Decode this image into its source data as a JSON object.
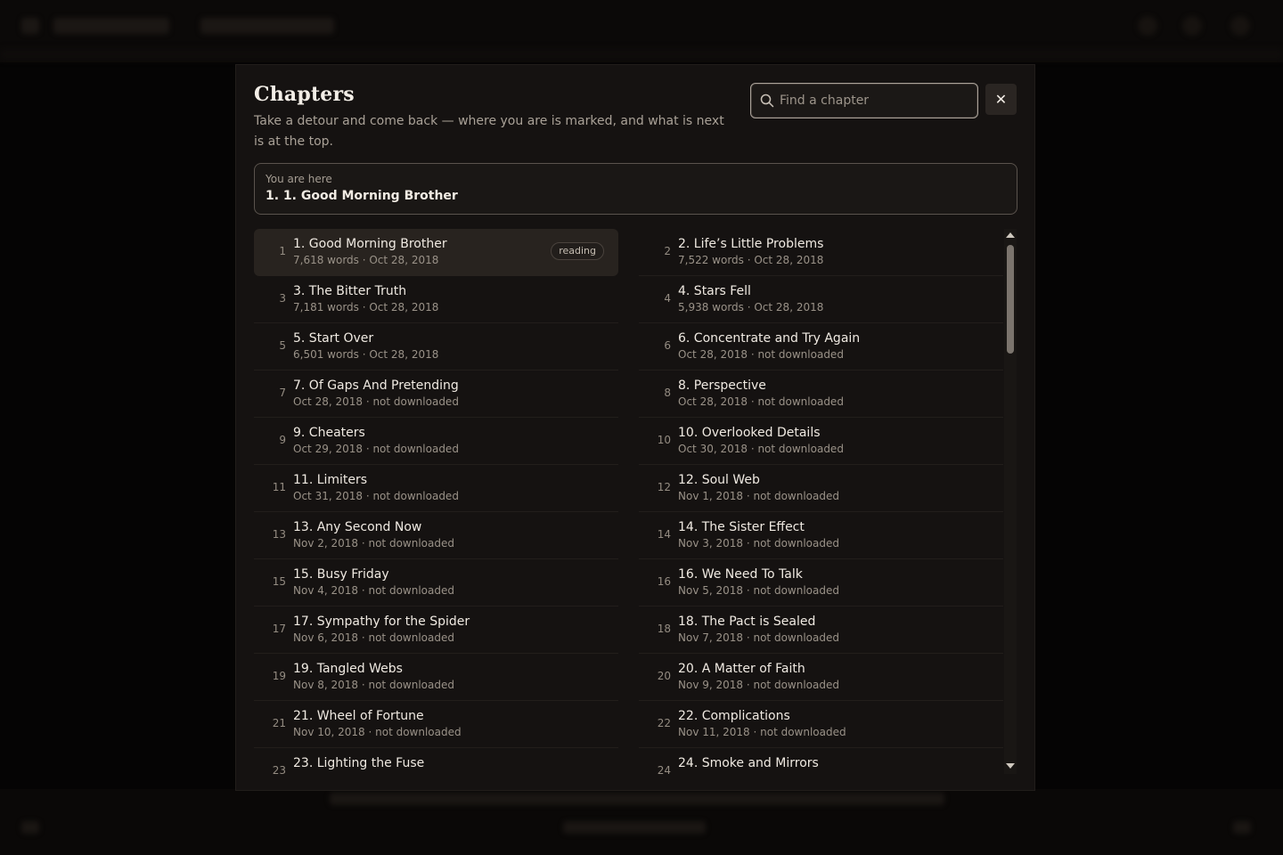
{
  "modal": {
    "title": "Chapters",
    "subtitle": "Take a detour and come back — where you are is marked, and what is next is at the top.",
    "search": {
      "placeholder": "Find a chapter",
      "value": ""
    },
    "close_label": "✕",
    "current": {
      "label": "You are here",
      "value": "1. 1. Good Morning Brother"
    },
    "reading_badge": "reading",
    "chapters": [
      {
        "num": "1",
        "title": "1. Good Morning Brother",
        "meta": "7,618 words · Oct 28, 2018",
        "active": true
      },
      {
        "num": "2",
        "title": "2. Life’s Little Problems",
        "meta": "7,522 words · Oct 28, 2018"
      },
      {
        "num": "3",
        "title": "3. The Bitter Truth",
        "meta": "7,181 words · Oct 28, 2018"
      },
      {
        "num": "4",
        "title": "4. Stars Fell",
        "meta": "5,938 words · Oct 28, 2018"
      },
      {
        "num": "5",
        "title": "5. Start Over",
        "meta": "6,501 words · Oct 28, 2018"
      },
      {
        "num": "6",
        "title": "6. Concentrate and Try Again",
        "meta": "Oct 28, 2018 · not downloaded"
      },
      {
        "num": "7",
        "title": "7. Of Gaps And Pretending",
        "meta": "Oct 28, 2018 · not downloaded"
      },
      {
        "num": "8",
        "title": "8. Perspective",
        "meta": "Oct 28, 2018 · not downloaded"
      },
      {
        "num": "9",
        "title": "9. Cheaters",
        "meta": "Oct 29, 2018 · not downloaded"
      },
      {
        "num": "10",
        "title": "10. Overlooked Details",
        "meta": "Oct 30, 2018 · not downloaded"
      },
      {
        "num": "11",
        "title": "11. Limiters",
        "meta": "Oct 31, 2018 · not downloaded"
      },
      {
        "num": "12",
        "title": "12. Soul Web",
        "meta": "Nov 1, 2018 · not downloaded"
      },
      {
        "num": "13",
        "title": "13. Any Second Now",
        "meta": "Nov 2, 2018 · not downloaded"
      },
      {
        "num": "14",
        "title": "14. The Sister Effect",
        "meta": "Nov 3, 2018 · not downloaded"
      },
      {
        "num": "15",
        "title": "15. Busy Friday",
        "meta": "Nov 4, 2018 · not downloaded"
      },
      {
        "num": "16",
        "title": "16. We Need To Talk",
        "meta": "Nov 5, 2018 · not downloaded"
      },
      {
        "num": "17",
        "title": "17. Sympathy for the Spider",
        "meta": "Nov 6, 2018 · not downloaded"
      },
      {
        "num": "18",
        "title": "18. The Pact is Sealed",
        "meta": "Nov 7, 2018 · not downloaded"
      },
      {
        "num": "19",
        "title": "19. Tangled Webs",
        "meta": "Nov 8, 2018 · not downloaded"
      },
      {
        "num": "20",
        "title": "20. A Matter of Faith",
        "meta": "Nov 9, 2018 · not downloaded"
      },
      {
        "num": "21",
        "title": "21. Wheel of Fortune",
        "meta": "Nov 10, 2018 · not downloaded"
      },
      {
        "num": "22",
        "title": "22. Complications",
        "meta": "Nov 11, 2018 · not downloaded"
      },
      {
        "num": "23",
        "title": "23. Lighting the Fuse",
        "meta": ""
      },
      {
        "num": "24",
        "title": "24. Smoke and Mirrors",
        "meta": ""
      }
    ]
  },
  "icons": {
    "search": "search-icon",
    "close": "close-icon",
    "scroll_up": "chevron-up-icon",
    "scroll_down": "chevron-down-icon"
  },
  "colors": {
    "modal_bg": "#151211",
    "accent_border": "#aba39a",
    "active_row": "#28231f"
  }
}
